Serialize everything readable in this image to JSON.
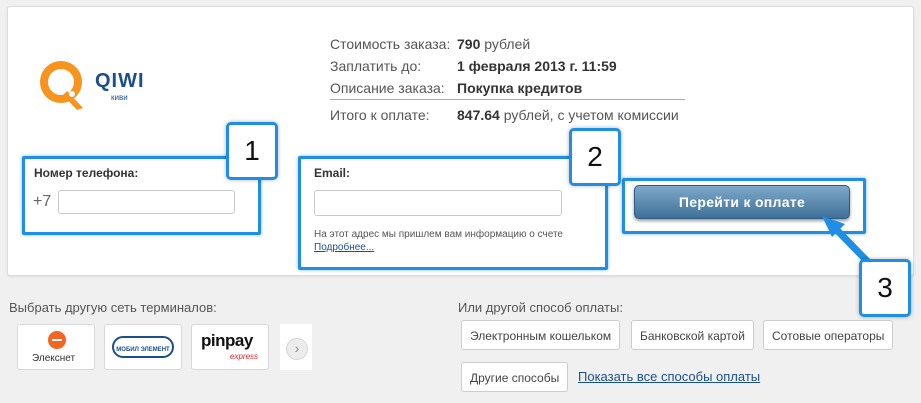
{
  "logo": {
    "name": "QIWI",
    "sub": "киви"
  },
  "order": {
    "cost_label": "Стоимость заказа:",
    "cost_value": "790",
    "cost_currency": " рублей",
    "pay_until_label": "Заплатить до:",
    "pay_until_value": "1 февраля 2013 г. 11:59",
    "description_label": "Описание заказа:",
    "description_value": "Покупка кредитов",
    "total_label": "Итого к оплате:",
    "total_value": "847.64",
    "total_suffix": " рублей, с учетом комиссии"
  },
  "phone": {
    "label": "Номер телефона:",
    "prefix": "+7",
    "value": "",
    "placeholder": ""
  },
  "email": {
    "label": "Email:",
    "value": "",
    "placeholder": "",
    "hint": "На этот адрес мы пришлем вам информацию о счете",
    "more_link": "Подробнее..."
  },
  "pay_button": {
    "label": "Перейти к оплате"
  },
  "markers": {
    "one": "1",
    "two": "2",
    "three": "3"
  },
  "terminals": {
    "label": "Выбрать другую сеть терминалов:",
    "items": [
      "Элекснет",
      "МОБИЛ ЭЛЕМЕНТ",
      "pinpay",
      "express"
    ]
  },
  "other_methods": {
    "label": "Или другой способ оплаты:",
    "options": [
      "Электронным кошельком",
      "Банковской картой",
      "Сотовые операторы",
      "Другие способы"
    ],
    "show_all_link": "Показать все способы оплаты"
  },
  "colors": {
    "highlight": "#1e8ee6",
    "brand_blue": "#1a4e8c",
    "qiwi_orange": "#f7941d",
    "button": "#3f7098"
  }
}
